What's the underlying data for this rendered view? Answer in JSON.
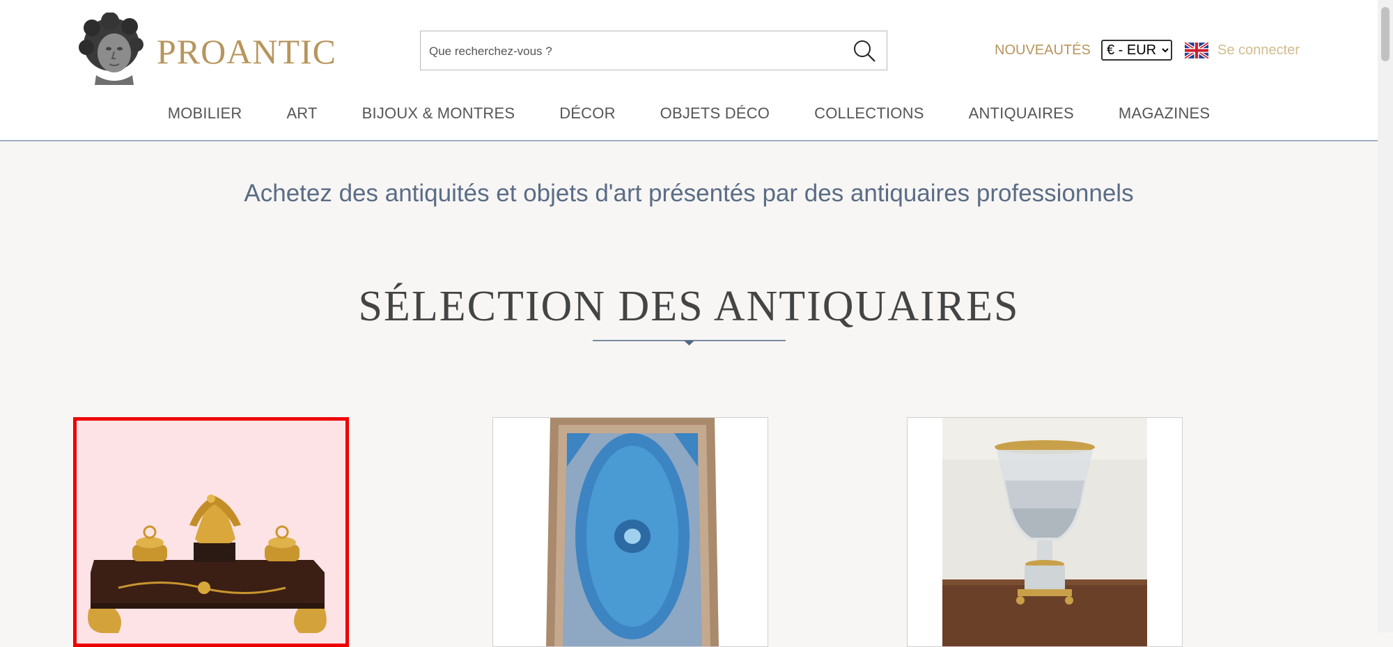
{
  "header": {
    "logo_text": "PROANTIC",
    "search": {
      "placeholder": "Que recherchez-vous ?",
      "value": ""
    },
    "nouveautes_label": "NOUVEAUTÉS",
    "currency": {
      "selected": "€ - EUR"
    },
    "language_flag": "uk-flag-icon",
    "login_label": "Se connecter"
  },
  "nav": {
    "items": [
      {
        "label": "MOBILIER"
      },
      {
        "label": "ART"
      },
      {
        "label": "BIJOUX & MONTRES"
      },
      {
        "label": "DÉCOR"
      },
      {
        "label": "OBJETS DÉCO"
      },
      {
        "label": "COLLECTIONS"
      },
      {
        "label": "ANTIQUAIRES"
      },
      {
        "label": "MAGAZINES"
      }
    ]
  },
  "main": {
    "tagline": "Achetez des antiquités et objets d'art présentés par des antiquaires professionnels",
    "section_title": "SÉLECTION DES ANTIQUAIRES",
    "cards": [
      {
        "image": "empire-inkwell-eagle",
        "selected": true
      },
      {
        "image": "blue-oriental-rug",
        "selected": false
      },
      {
        "image": "crystal-medici-vase",
        "selected": false
      }
    ]
  },
  "colors": {
    "brand_gold": "#b7955c",
    "tagline_blue": "#5a6c86",
    "selection_red": "#ee0000",
    "page_background": "#f7f6f4"
  }
}
